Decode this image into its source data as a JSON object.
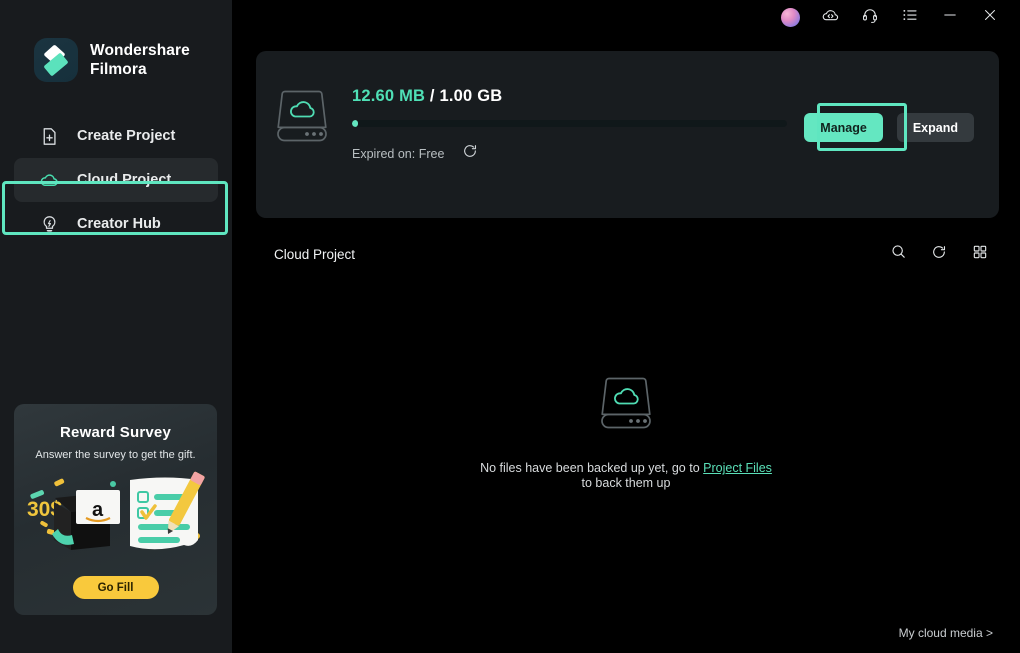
{
  "app": {
    "brand_name": "Wondershare\nFilmora",
    "brand_logo_icon": "filmora-logo-icon"
  },
  "titlebar": {
    "avatar_icon": "user-avatar",
    "buttons": [
      {
        "icon": "cloud-download-icon",
        "name": "cloud-download-button"
      },
      {
        "icon": "headset-support-icon",
        "name": "support-button"
      },
      {
        "icon": "list-menu-icon",
        "name": "menu-button"
      },
      {
        "icon": "minimize-icon",
        "name": "minimize-button"
      },
      {
        "icon": "close-icon",
        "name": "close-button"
      }
    ]
  },
  "sidebar": {
    "items": [
      {
        "label": "Create Project",
        "icon": "new-document-plus-icon",
        "active": false
      },
      {
        "label": "Cloud Project",
        "icon": "cloud-icon",
        "active": true
      },
      {
        "label": "Creator Hub",
        "icon": "lightbulb-bolt-icon",
        "active": false
      }
    ],
    "promo": {
      "title": "Reward Survey",
      "subtitle": "Answer the survey to get the gift.",
      "amount_badge": "30$",
      "gift_card_letter": "a",
      "button_label": "Go Fill"
    }
  },
  "storage": {
    "drive_icon": "cloud-drive-icon",
    "used": "12.60 MB",
    "separator": " / ",
    "total": "1.00 GB",
    "progress_percent": 1.2,
    "expiry_label": "Expired on: Free",
    "refresh_icon": "refresh-icon",
    "manage_label": "Manage",
    "expand_label": "Expand",
    "accent_color": "#64E7C1",
    "card_bg": "#181C1F"
  },
  "content": {
    "section_title": "Cloud Project",
    "tools": [
      {
        "icon": "search-icon",
        "name": "search-button"
      },
      {
        "icon": "refresh-icon",
        "name": "refresh-button"
      },
      {
        "icon": "grid-view-icon",
        "name": "grid-view-button"
      }
    ],
    "empty_state": {
      "icon": "cloud-drive-icon",
      "line1_prefix": "No files have been backed up yet, go to ",
      "link": "Project Files",
      "line2": "to back them up"
    },
    "footer_link": "My cloud media >"
  },
  "highlights": {
    "sidebar_ring_color": "#5FE6C0",
    "manage_ring_color": "#5FE6C0"
  }
}
